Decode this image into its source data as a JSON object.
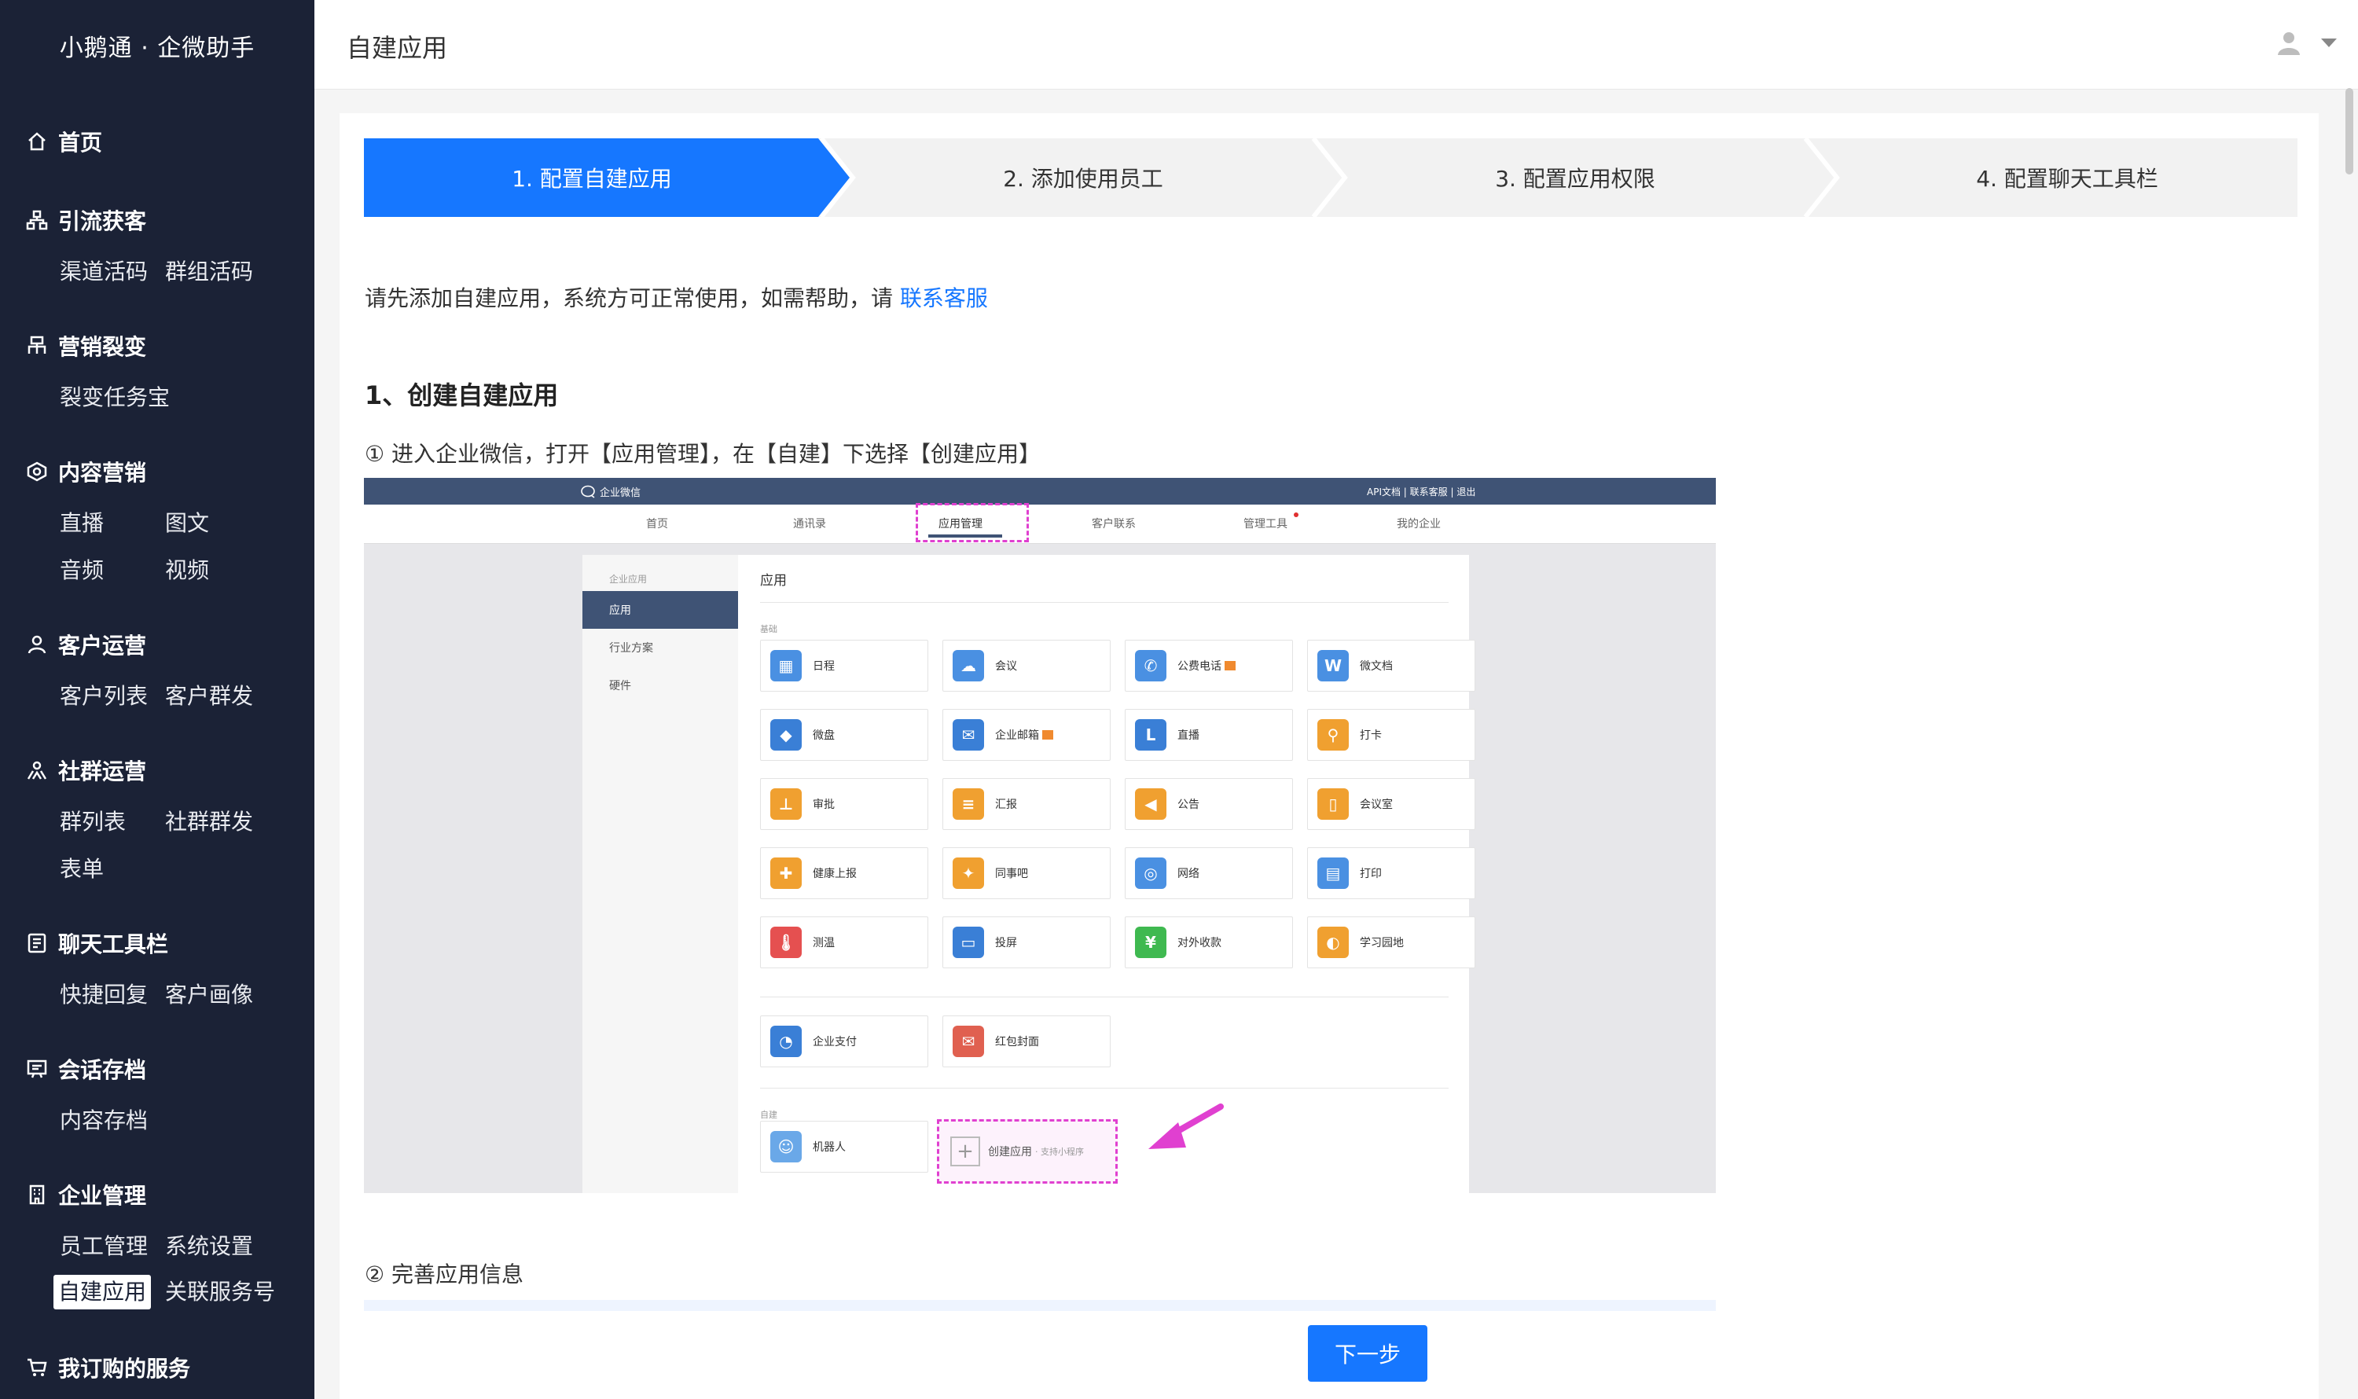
{
  "app": {
    "brand": "小鹅通 · 企微助手"
  },
  "header": {
    "title": "自建应用"
  },
  "sidebar": {
    "sections": [
      {
        "title": "首页",
        "icon": "home-icon",
        "items": []
      },
      {
        "title": "引流获客",
        "icon": "sitemap-icon",
        "items": [
          "渠道活码",
          "群组活码"
        ]
      },
      {
        "title": "营销裂变",
        "icon": "org-chart-icon",
        "items": [
          "裂变任务宝"
        ]
      },
      {
        "title": "内容营销",
        "icon": "content-icon",
        "items": [
          "直播",
          "图文",
          "音频",
          "视频"
        ]
      },
      {
        "title": "客户运营",
        "icon": "user-icon",
        "items": [
          "客户列表",
          "客户群发"
        ]
      },
      {
        "title": "社群运营",
        "icon": "group-icon",
        "items": [
          "群列表",
          "社群群发",
          "表单"
        ]
      },
      {
        "title": "聊天工具栏",
        "icon": "toolbar-icon",
        "items": [
          "快捷回复",
          "客户画像"
        ]
      },
      {
        "title": "会话存档",
        "icon": "archive-icon",
        "items": [
          "内容存档"
        ]
      },
      {
        "title": "企业管理",
        "icon": "building-icon",
        "items": [
          "员工管理",
          "系统设置",
          "自建应用",
          "关联服务号"
        ]
      },
      {
        "title": "我订购的服务",
        "icon": "cart-icon",
        "items": []
      }
    ],
    "active_item": "自建应用"
  },
  "steps": [
    "1. 配置自建应用",
    "2. 添加使用员工",
    "3. 配置应用权限",
    "4. 配置聊天工具栏"
  ],
  "active_step": 0,
  "intro": {
    "text": "请先添加自建应用，系统方可正常使用，如需帮助，请 ",
    "link": "联系客服"
  },
  "section1_title": "1、创建自建应用",
  "step1_text": "① 进入企业微信，打开【应用管理】，在【自建】下选择【创建应用】",
  "step2_text": "② 完善应用信息",
  "next_button": "下一步",
  "colors": {
    "primary": "#1677ff",
    "sidebar_bg": "#1b2236",
    "step_inactive": "#f2f2f2",
    "highlight": "#e040d0"
  },
  "screenshot": {
    "logo": "企业微信",
    "top_links": "API文档 | 联系客服 | 退出",
    "nav": [
      "首页",
      "通讯录",
      "应用管理",
      "客户联系",
      "管理工具",
      "我的企业"
    ],
    "left_title": "企业应用",
    "left_items": [
      "应用",
      "行业方案",
      "硬件"
    ],
    "main_title": "应用",
    "basic_label": "基础",
    "apps": [
      {
        "name": "日程",
        "color": "#4a90e2",
        "glyph": "▦"
      },
      {
        "name": "会议",
        "color": "#4a90e2",
        "glyph": "☁"
      },
      {
        "name": "公费电话",
        "color": "#4a90e2",
        "glyph": "✆",
        "badge": true
      },
      {
        "name": "微文档",
        "color": "#4a90e2",
        "glyph": "W"
      },
      {
        "name": "微盘",
        "color": "#3a7fd6",
        "glyph": "◆"
      },
      {
        "name": "企业邮箱",
        "color": "#3a7fd6",
        "glyph": "✉",
        "badge": true
      },
      {
        "name": "直播",
        "color": "#3a7fd6",
        "glyph": "L"
      },
      {
        "name": "打卡",
        "color": "#f0a030",
        "glyph": "⚲"
      },
      {
        "name": "审批",
        "color": "#f0a030",
        "glyph": "⊥"
      },
      {
        "name": "汇报",
        "color": "#f0a030",
        "glyph": "≡"
      },
      {
        "name": "公告",
        "color": "#f0a030",
        "glyph": "◀"
      },
      {
        "name": "会议室",
        "color": "#f0a030",
        "glyph": "▯"
      },
      {
        "name": "健康上报",
        "color": "#f0a030",
        "glyph": "✚"
      },
      {
        "name": "同事吧",
        "color": "#f0a030",
        "glyph": "✦"
      },
      {
        "name": "网络",
        "color": "#4a90e2",
        "glyph": "◎"
      },
      {
        "name": "打印",
        "color": "#4a90e2",
        "glyph": "▤"
      },
      {
        "name": "测温",
        "color": "#e55050",
        "glyph": "🌡"
      },
      {
        "name": "投屏",
        "color": "#3a7fd6",
        "glyph": "▭"
      },
      {
        "name": "对外收款",
        "color": "#3fb950",
        "glyph": "¥"
      },
      {
        "name": "学习园地",
        "color": "#f0a030",
        "glyph": "◐"
      }
    ],
    "pay_apps": [
      {
        "name": "企业支付",
        "color": "#3a7fd6",
        "glyph": "◔"
      },
      {
        "name": "红包封面",
        "color": "#e06050",
        "glyph": "✉"
      }
    ],
    "custom_label": "自建",
    "robot": "机器人",
    "create_app": "创建应用",
    "create_app_sub": "· 支持小程序"
  }
}
